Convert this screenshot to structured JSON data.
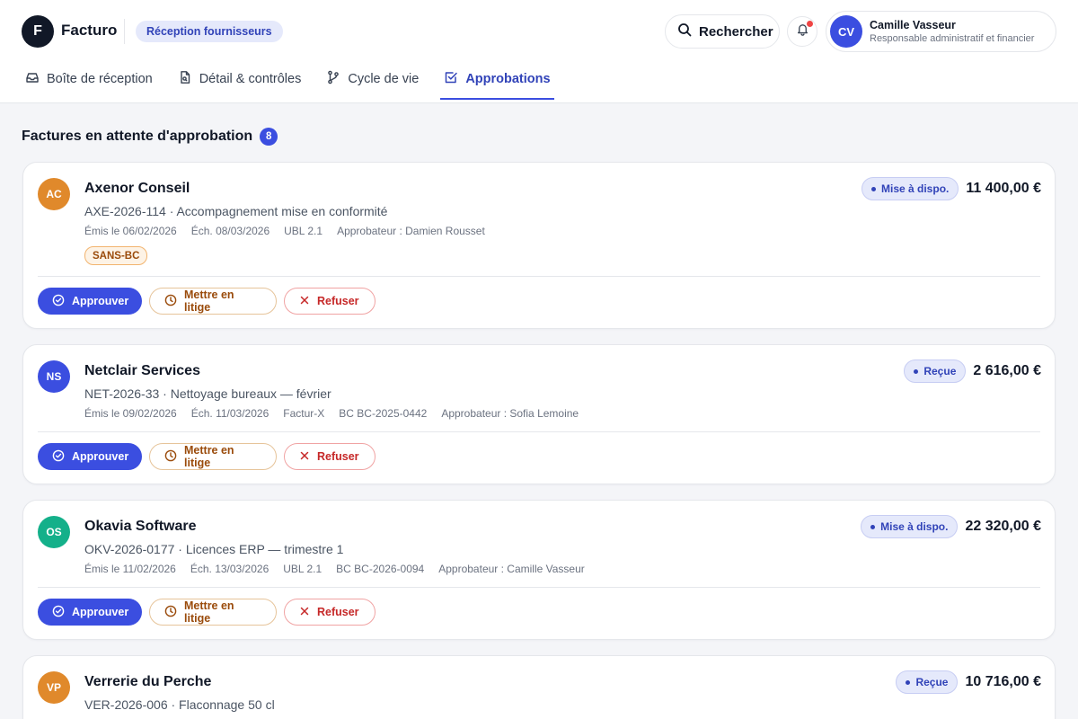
{
  "brand": {
    "logo_letter": "F",
    "name": "Facturo",
    "context": "Réception fournisseurs"
  },
  "header": {
    "search_label": "Rechercher",
    "user": {
      "initials": "CV",
      "name": "Camille Vasseur",
      "role": "Responsable administratif et financier"
    }
  },
  "tabs": [
    {
      "label": "Boîte de réception",
      "icon": "inbox-icon",
      "active": false
    },
    {
      "label": "Détail & contrôles",
      "icon": "document-search-icon",
      "active": false
    },
    {
      "label": "Cycle de vie",
      "icon": "git-branch-icon",
      "active": false
    },
    {
      "label": "Approbations",
      "icon": "checkbox-icon",
      "active": true
    }
  ],
  "section": {
    "title": "Factures en attente d'approbation",
    "count": "8"
  },
  "actions": {
    "approve": "Approuver",
    "dispute": "Mettre en litige",
    "refuse": "Refuser"
  },
  "invoices": [
    {
      "initials": "AC",
      "avatar_color": "#e0892b",
      "supplier": "Axenor Conseil",
      "description": "AXE-2026-114 · Accompagnement mise en conformité",
      "meta": [
        "Émis le 06/02/2026",
        "Éch. 08/03/2026",
        "UBL 2.1",
        "Approbateur : Damien Rousset"
      ],
      "tag": "SANS-BC",
      "status": "Mise à dispo.",
      "amount": "11 400,00 €"
    },
    {
      "initials": "NS",
      "avatar_color": "#3b4ee0",
      "supplier": "Netclair Services",
      "description": "NET-2026-33 · Nettoyage bureaux — février",
      "meta": [
        "Émis le 09/02/2026",
        "Éch. 11/03/2026",
        "Factur-X",
        "BC BC-2025-0442",
        "Approbateur : Sofia Lemoine"
      ],
      "tag": "",
      "status": "Reçue",
      "amount": "2 616,00 €"
    },
    {
      "initials": "OS",
      "avatar_color": "#14b08a",
      "supplier": "Okavia Software",
      "description": "OKV-2026-0177 · Licences ERP — trimestre 1",
      "meta": [
        "Émis le 11/02/2026",
        "Éch. 13/03/2026",
        "UBL 2.1",
        "BC BC-2026-0094",
        "Approbateur : Camille Vasseur"
      ],
      "tag": "",
      "status": "Mise à dispo.",
      "amount": "22 320,00 €"
    },
    {
      "initials": "VP",
      "avatar_color": "#e0892b",
      "supplier": "Verrerie du Perche",
      "description": "VER-2026-006 · Flaconnage 50 cl",
      "meta": [],
      "tag": "",
      "status": "Reçue",
      "amount": "10 716,00 €"
    }
  ]
}
